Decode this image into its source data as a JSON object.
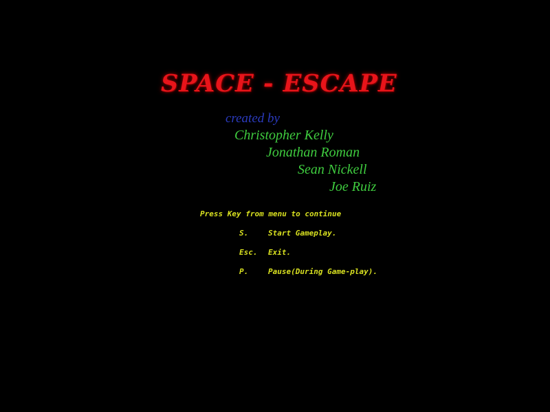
{
  "colors": {
    "background": "#000000",
    "title": "#e8141a",
    "credits_label": "#2b3bbf",
    "credit_names": "#3fcc3f",
    "menu_text": "#d8e020"
  },
  "title": "SPACE - ESCAPE",
  "credits": {
    "label": "created by",
    "names": [
      "Christopher Kelly",
      "Jonathan Roman",
      "Sean Nickell",
      "Joe Ruiz"
    ]
  },
  "menu": {
    "prompt": "Press Key from menu to continue",
    "items": [
      {
        "key": "S.",
        "action": "Start Gameplay."
      },
      {
        "key": "Esc.",
        "action": "Exit."
      },
      {
        "key": "P.",
        "action": "Pause(During Game-play)."
      }
    ]
  }
}
